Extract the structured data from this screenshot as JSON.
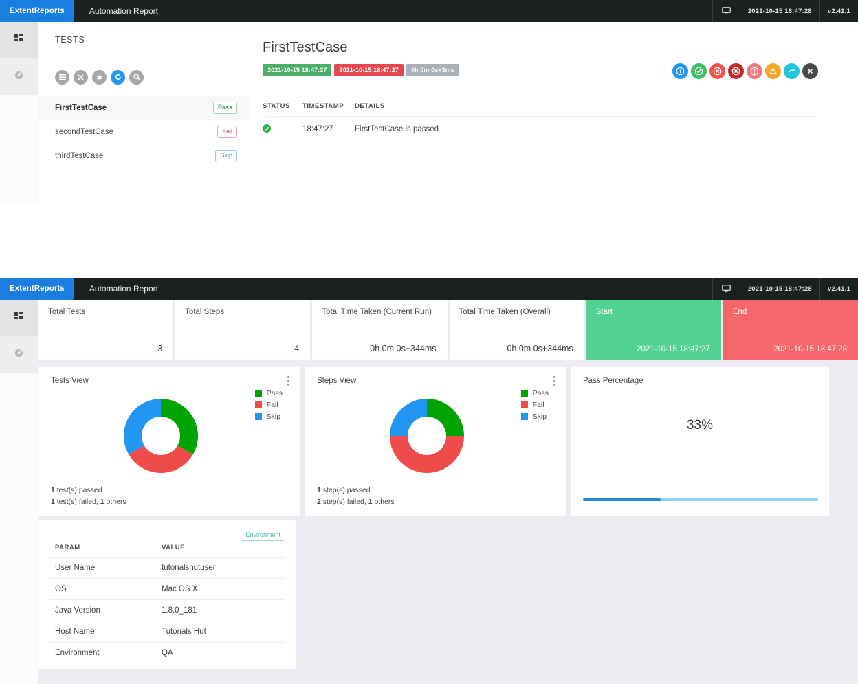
{
  "navbar": {
    "brand": "ExtentReports",
    "title": "Automation Report",
    "monitor_icon": "monitor-icon",
    "timestamp": "2021-10-15 18:47:28",
    "version": "v2.41.1"
  },
  "rail": {
    "items": [
      {
        "name": "dashboard-icon",
        "label": "Dashboard"
      },
      {
        "name": "pie-chart-icon",
        "label": "Charts"
      }
    ]
  },
  "tests_panel": {
    "heading": "TESTS",
    "filters": [
      {
        "icon": "list-icon",
        "glyph": "☰",
        "color": "#a7a7a7"
      },
      {
        "icon": "close-icon",
        "glyph": "✕",
        "color": "#a7a7a7"
      },
      {
        "icon": "bug-icon",
        "glyph": "☸",
        "color": "#a7a7a7"
      },
      {
        "icon": "refresh-icon",
        "glyph": "⟳",
        "color": "#2196f3"
      },
      {
        "icon": "search-icon",
        "glyph": "⌕",
        "color": "#a7a7a7"
      }
    ],
    "tests": [
      {
        "name": "FirstTestCase",
        "status": "Pass",
        "status_class": "pass",
        "selected": true
      },
      {
        "name": "secondTestCase",
        "status": "Fail",
        "status_class": "fail",
        "selected": false
      },
      {
        "name": "thirdTestCase",
        "status": "Skip",
        "status_class": "skip",
        "selected": false
      }
    ]
  },
  "detail": {
    "title": "FirstTestCase",
    "chips": [
      {
        "text": "2021-10-15 18:47:27",
        "kind": "green"
      },
      {
        "text": "2021-10-15 18:47:27",
        "kind": "red"
      },
      {
        "text": "0h 0m 0s+3ms",
        "kind": "gray"
      }
    ],
    "status_icons": [
      {
        "name": "info-icon",
        "glyph": "i",
        "color": "#2196f3"
      },
      {
        "name": "check-icon",
        "glyph": "✔",
        "color": "#3fbf63"
      },
      {
        "name": "fail-icon",
        "glyph": "✕",
        "color": "#ef5350"
      },
      {
        "name": "error-icon",
        "glyph": "✕",
        "color": "#c62828"
      },
      {
        "name": "fatal-icon",
        "glyph": "❗",
        "color": "#ef7b80"
      },
      {
        "name": "warning-icon",
        "glyph": "▲",
        "color": "#f5a623"
      },
      {
        "name": "skip-icon",
        "glyph": "↷",
        "color": "#22c3dd"
      },
      {
        "name": "exception-icon",
        "glyph": "✕",
        "color": "#4a4a4a"
      }
    ],
    "table": {
      "columns": [
        "STATUS",
        "TIMESTAMP",
        "DETAILS"
      ],
      "rows": [
        {
          "status": "pass",
          "timestamp": "18:47:27",
          "details": "FirstTestCase is passed"
        }
      ]
    }
  },
  "dashboard": {
    "kpis": [
      {
        "label": "Total Tests",
        "value": "3",
        "kind": "plain"
      },
      {
        "label": "Total Steps",
        "value": "4",
        "kind": "plain"
      },
      {
        "label": "Total Time Taken (Current Run)",
        "value": "0h 0m 0s+344ms",
        "kind": "plain"
      },
      {
        "label": "Total Time Taken (Overall)",
        "value": "0h 0m 0s+344ms",
        "kind": "plain"
      },
      {
        "label": "Start",
        "value": "2021-10-15 18:47:27",
        "kind": "green"
      },
      {
        "label": "End",
        "value": "2021-10-15 18:47:28",
        "kind": "red"
      }
    ],
    "tests_view": {
      "title": "Tests View",
      "footer_line1_bold": "1",
      "footer_line1": " test(s) passed",
      "footer_line2": "1 test(s) failed, 1 others"
    },
    "steps_view": {
      "title": "Steps View",
      "footer_line1": "1 step(s) passed",
      "footer_line2": "2 step(s) failed, 1 others"
    },
    "pass_percentage": {
      "title": "Pass Percentage",
      "value": "33%",
      "progress": 33
    },
    "environment": {
      "badge": "Environment",
      "columns": [
        "PARAM",
        "VALUE"
      ],
      "rows": [
        {
          "param": "User Name",
          "value": "tutorialshutuser"
        },
        {
          "param": "OS",
          "value": "Mac OS X"
        },
        {
          "param": "Java Version",
          "value": "1.8.0_181"
        },
        {
          "param": "Host Name",
          "value": "Tutorials Hut"
        },
        {
          "param": "Environment",
          "value": "QA"
        }
      ]
    }
  },
  "colors": {
    "brand_blue": "#1a7ee0",
    "navbar_dark": "#1b211f",
    "pass_green": "#00a400",
    "fail_red": "#ef4b4b",
    "skip_blue": "#2196f3",
    "start_green": "#52d193",
    "end_red": "#f4676b",
    "dash_bg": "#ebedf3"
  },
  "chart_data": [
    {
      "type": "pie",
      "title": "Tests View",
      "labels": [
        "Pass",
        "Fail",
        "Skip"
      ],
      "values": [
        1,
        1,
        1
      ],
      "colors": [
        "#00a400",
        "#ef4b4b",
        "#2196f3"
      ],
      "legend_position": "right",
      "donut": true,
      "total": 3
    },
    {
      "type": "pie",
      "title": "Steps View",
      "labels": [
        "Pass",
        "Fail",
        "Skip"
      ],
      "values": [
        1,
        2,
        1
      ],
      "colors": [
        "#00a400",
        "#ef4b4b",
        "#2196f3"
      ],
      "legend_position": "right",
      "donut": true,
      "total": 4
    },
    {
      "type": "bar",
      "title": "Pass Percentage",
      "categories": [
        "Pass Percentage"
      ],
      "values": [
        33
      ],
      "ylim": [
        0,
        100
      ],
      "ylabel": "%",
      "colors": [
        "#1e88d6"
      ],
      "track_color": "#8fd3f4"
    }
  ]
}
